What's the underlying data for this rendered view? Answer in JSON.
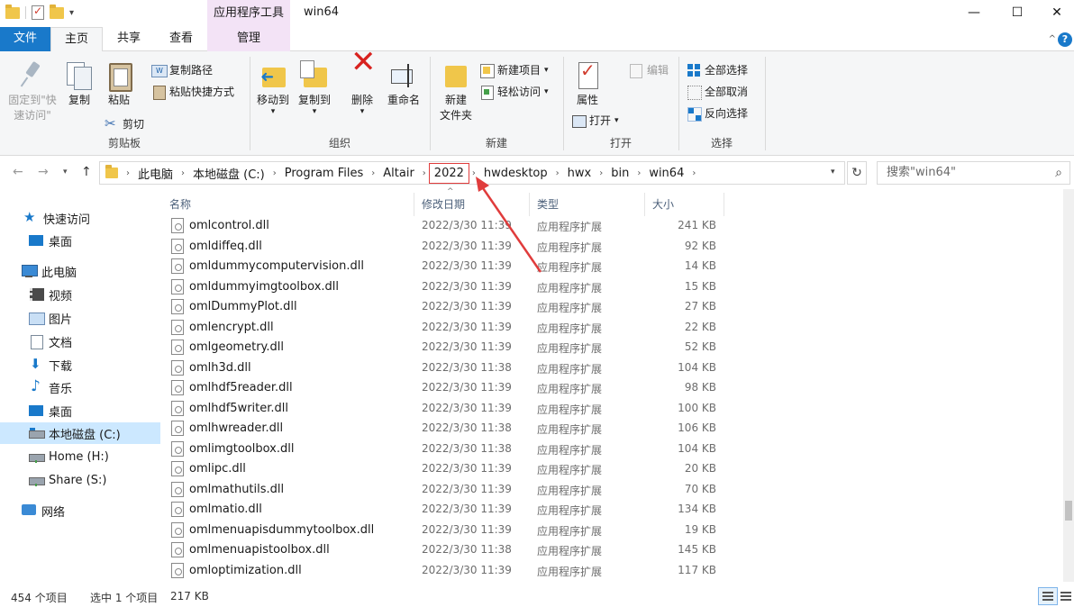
{
  "window": {
    "title": "win64",
    "context_tab": "应用程序工具",
    "minimize": "—",
    "maximize": "☐",
    "close": "✕"
  },
  "tabs": {
    "file": "文件",
    "home": "主页",
    "share": "共享",
    "view": "查看",
    "manage": "管理"
  },
  "ribbon": {
    "clipboard": {
      "label": "剪贴板",
      "pin": "固定到\"快\n速访问\"",
      "pin_l1": "固定到\"快",
      "pin_l2": "速访问\"",
      "copy": "复制",
      "paste": "粘贴",
      "copy_path": "复制路径",
      "paste_shortcut": "粘贴快捷方式",
      "cut": "剪切"
    },
    "organize": {
      "label": "组织",
      "move_to": "移动到",
      "copy_to": "复制到",
      "delete": "删除",
      "rename": "重命名"
    },
    "new": {
      "label": "新建",
      "new_folder_l1": "新建",
      "new_folder_l2": "文件夹",
      "new_item": "新建项目",
      "easy_access": "轻松访问"
    },
    "open": {
      "label": "打开",
      "properties": "属性",
      "open": "打开",
      "edit": "编辑"
    },
    "select": {
      "label": "选择",
      "select_all": "全部选择",
      "select_none": "全部取消",
      "invert": "反向选择"
    }
  },
  "address": {
    "crumbs": [
      "此电脑",
      "本地磁盘 (C:)",
      "Program Files",
      "Altair",
      "2022",
      "hwdesktop",
      "hwx",
      "bin",
      "win64"
    ],
    "highlighted_crumb": "2022",
    "search_placeholder": "搜索\"win64\""
  },
  "nav": {
    "items": [
      {
        "label": "快速访问",
        "icon": "star-icon"
      },
      {
        "label": "桌面",
        "icon": "desktop-icon"
      },
      {
        "label": "此电脑",
        "icon": "pc-icon"
      },
      {
        "label": "视频",
        "icon": "video-icon"
      },
      {
        "label": "图片",
        "icon": "pictures-icon"
      },
      {
        "label": "文档",
        "icon": "documents-icon"
      },
      {
        "label": "下载",
        "icon": "download-icon"
      },
      {
        "label": "音乐",
        "icon": "music-icon"
      },
      {
        "label": "桌面",
        "icon": "desktop-icon"
      },
      {
        "label": "本地磁盘 (C:)",
        "icon": "drive-icon"
      },
      {
        "label": "Home (H:)",
        "icon": "network-drive-icon"
      },
      {
        "label": "Share (S:)",
        "icon": "network-drive-icon"
      },
      {
        "label": "网络",
        "icon": "network-icon"
      }
    ]
  },
  "list": {
    "columns": [
      "名称",
      "修改日期",
      "类型",
      "大小"
    ],
    "rows": [
      {
        "name": "omlcontrol.dll",
        "date": "2022/3/30 11:39",
        "type": "应用程序扩展",
        "size": "241 KB"
      },
      {
        "name": "omldiffeq.dll",
        "date": "2022/3/30 11:39",
        "type": "应用程序扩展",
        "size": "92 KB"
      },
      {
        "name": "omldummycomputervision.dll",
        "date": "2022/3/30 11:39",
        "type": "应用程序扩展",
        "size": "14 KB"
      },
      {
        "name": "omldummyimgtoolbox.dll",
        "date": "2022/3/30 11:39",
        "type": "应用程序扩展",
        "size": "15 KB"
      },
      {
        "name": "omlDummyPlot.dll",
        "date": "2022/3/30 11:39",
        "type": "应用程序扩展",
        "size": "27 KB"
      },
      {
        "name": "omlencrypt.dll",
        "date": "2022/3/30 11:39",
        "type": "应用程序扩展",
        "size": "22 KB"
      },
      {
        "name": "omlgeometry.dll",
        "date": "2022/3/30 11:39",
        "type": "应用程序扩展",
        "size": "52 KB"
      },
      {
        "name": "omlh3d.dll",
        "date": "2022/3/30 11:38",
        "type": "应用程序扩展",
        "size": "104 KB"
      },
      {
        "name": "omlhdf5reader.dll",
        "date": "2022/3/30 11:39",
        "type": "应用程序扩展",
        "size": "98 KB"
      },
      {
        "name": "omlhdf5writer.dll",
        "date": "2022/3/30 11:39",
        "type": "应用程序扩展",
        "size": "100 KB"
      },
      {
        "name": "omlhwreader.dll",
        "date": "2022/3/30 11:38",
        "type": "应用程序扩展",
        "size": "106 KB"
      },
      {
        "name": "omlimgtoolbox.dll",
        "date": "2022/3/30 11:38",
        "type": "应用程序扩展",
        "size": "104 KB"
      },
      {
        "name": "omlipc.dll",
        "date": "2022/3/30 11:39",
        "type": "应用程序扩展",
        "size": "20 KB"
      },
      {
        "name": "omlmathutils.dll",
        "date": "2022/3/30 11:39",
        "type": "应用程序扩展",
        "size": "70 KB"
      },
      {
        "name": "omlmatio.dll",
        "date": "2022/3/30 11:39",
        "type": "应用程序扩展",
        "size": "134 KB"
      },
      {
        "name": "omlmenuapisdummytoolbox.dll",
        "date": "2022/3/30 11:39",
        "type": "应用程序扩展",
        "size": "19 KB"
      },
      {
        "name": "omlmenuapistoolbox.dll",
        "date": "2022/3/30 11:38",
        "type": "应用程序扩展",
        "size": "145 KB"
      },
      {
        "name": "omloptimization.dll",
        "date": "2022/3/30 11:39",
        "type": "应用程序扩展",
        "size": "117 KB"
      }
    ]
  },
  "status": {
    "count": "454 个项目",
    "selected": "选中 1 个项目",
    "selected_size": "217 KB"
  },
  "colors": {
    "accent": "#1979ca",
    "context_tab_bg": "#f3e3f6",
    "selection": "#cce8ff",
    "annotation": "#e03c3c"
  }
}
